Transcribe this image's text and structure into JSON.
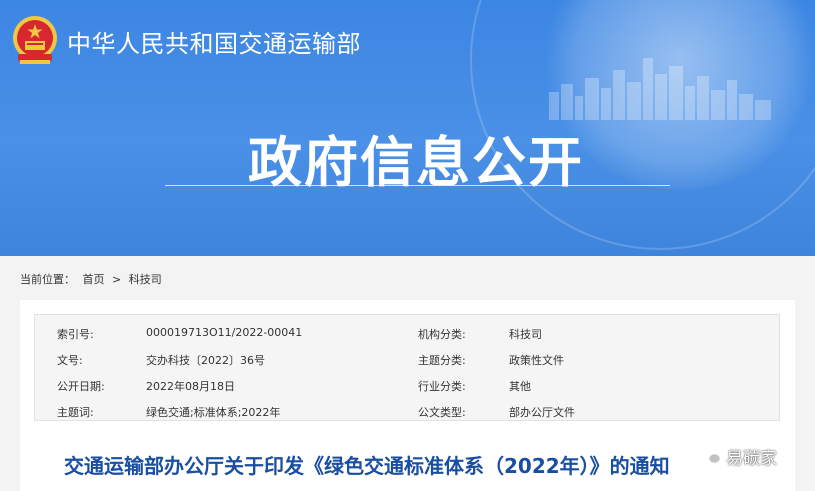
{
  "header": {
    "org_name": "中华人民共和国交通运输部",
    "section_title": "政府信息公开"
  },
  "breadcrumb": {
    "prefix": "当前位置：",
    "items": [
      "首页",
      "科技司"
    ],
    "separator": ">"
  },
  "meta": {
    "rows": [
      {
        "k1": "索引号:",
        "v1": "000019713O11/2022-00041",
        "k2": "机构分类:",
        "v2": "科技司"
      },
      {
        "k1": "文号:",
        "v1": "交办科技〔2022〕36号",
        "k2": "主题分类:",
        "v2": "政策性文件"
      },
      {
        "k1": "公开日期:",
        "v1": "2022年08月18日",
        "k2": "行业分类:",
        "v2": "其他"
      },
      {
        "k1": "主题词:",
        "v1": "绿色交通;标准体系;2022年",
        "k2": "公文类型:",
        "v2": "部办公厅文件"
      }
    ]
  },
  "document": {
    "title": "交通运输部办公厅关于印发《绿色交通标准体系（2022年）》的通知"
  },
  "watermark": {
    "text": "易碳家",
    "icon": "wechat-icon"
  },
  "colors": {
    "banner": "#4a90e6",
    "title_blue": "#1a4ea1",
    "emblem_red": "#d7282f",
    "emblem_gold": "#f2c744"
  }
}
